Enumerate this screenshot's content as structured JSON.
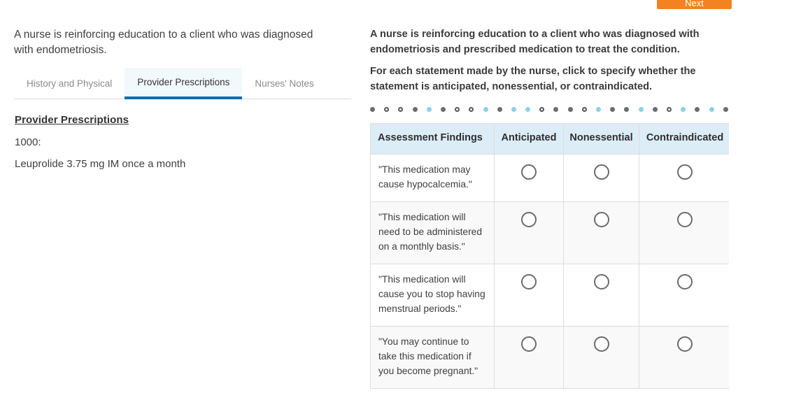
{
  "top_action": {
    "label": "Next"
  },
  "left_pane": {
    "case_intro": "A nurse is reinforcing education to a client who was diagnosed with endometriosis.",
    "tabs": [
      {
        "label": "History and Physical",
        "active": false
      },
      {
        "label": "Provider Prescriptions",
        "active": true
      },
      {
        "label": "Nurses' Notes",
        "active": false
      }
    ],
    "section_title": "Provider Prescriptions",
    "order_time": "1000:",
    "order_text": "Leuprolide 3.75 mg IM once a month"
  },
  "right_pane": {
    "prompt_paragraphs": [
      "A nurse is reinforcing education to a client who was diagnosed with endometriosis and prescribed medication to treat the condition.",
      "For each statement made by the nurse, click to specify whether the statement is anticipated, nonessential, or contraindicated."
    ],
    "dot_rule": [
      "solid",
      "ring",
      "ring",
      "solid",
      "blue",
      "solid",
      "ring",
      "ring",
      "blue",
      "solid",
      "blue",
      "blue",
      "ring",
      "solid",
      "solid",
      "ring",
      "blue",
      "solid",
      "solid",
      "blue",
      "solid",
      "ring",
      "blue",
      "solid",
      "blue",
      "solid"
    ],
    "matrix": {
      "columns": [
        "Assessment Findings",
        "Anticipated",
        "Nonessential",
        "Contraindicated"
      ],
      "rows": [
        {
          "finding": "\"This medication may cause hypocalcemia.\"",
          "selected": null
        },
        {
          "finding": "\"This medication will need to be administered on a monthly basis.\"",
          "selected": null
        },
        {
          "finding": "\"This medication will cause you to stop having menstrual periods.\"",
          "selected": null
        },
        {
          "finding": "\"You may continue to take this medication if you become pregnant.\"",
          "selected": null
        }
      ]
    }
  },
  "colors": {
    "accent_orange": "#f58220",
    "tab_active_blue": "#0a6db5",
    "tab_active_bg": "#f2f9fd",
    "table_header_bg": "#dcedf7",
    "dot_blue": "#8ed0e8",
    "dot_gray": "#6d6d6d"
  }
}
